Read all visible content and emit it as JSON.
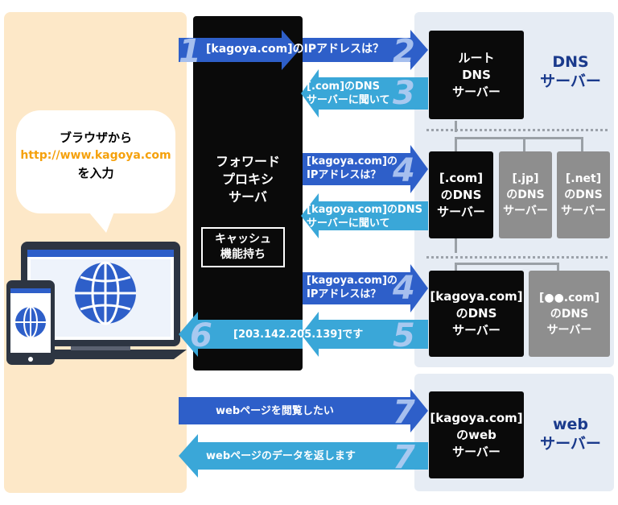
{
  "colors": {
    "client_panel": "#fde8c8",
    "server_panel": "#e6ecf4",
    "request_arrow": "#2e5fc9",
    "response_arrow": "#3aa7d8",
    "server_box": "#0a0a0a",
    "gray_server_box": "#8e8e8e",
    "label_blue": "#1a3a8c",
    "url_orange": "#f5a10c"
  },
  "client": {
    "bubble_line1": "ブラウザから",
    "bubble_url": "http://www.kagoya.com",
    "bubble_line3": "を入力",
    "icons": [
      "laptop-icon",
      "smartphone-icon",
      "globe-icon"
    ]
  },
  "proxy": {
    "title": "フォワード\nプロキシ\nサーバ",
    "cache": "キャッシュ\n機能持ち"
  },
  "dns": {
    "group_label": "DNS\nサーバー",
    "root": "ルート\nDNS\nサーバー",
    "com": "[.com]\nのDNS\nサーバー",
    "jp": "[.jp]\nのDNS\nサーバー",
    "net": "[.net]\nのDNS\nサーバー",
    "kagoya": "[kagoya.com]\nのDNS\nサーバー",
    "other": "[●●.com]\nのDNS\nサーバー"
  },
  "web": {
    "group_label": "web\nサーバー",
    "server": "[kagoya.com]\nのweb\nサーバー"
  },
  "flow": {
    "step1_num": "1",
    "step1_text": "[kagoya.com]のIPアドレスは？",
    "step2_num": "2",
    "step3_num": "3",
    "step3_text": "[.com]のDNS\nサーバーに聞いて",
    "step4a_num": "4",
    "step4a_text": "[kagoya.com]の\nIPアドレスは？",
    "step4b_text": "[kagoya.com]のDNS\nサーバーに聞いて",
    "step4c_num": "4",
    "step4c_text": "[kagoya.com]の\nIPアドレスは？",
    "step5_num": "5",
    "step5_text": "[203.142.205.139]です",
    "step6_num": "6",
    "step7a_num": "7",
    "step7a_text": "webページを閲覧したい",
    "step7b_num": "7",
    "step7b_text": "webページのデータを返します"
  }
}
